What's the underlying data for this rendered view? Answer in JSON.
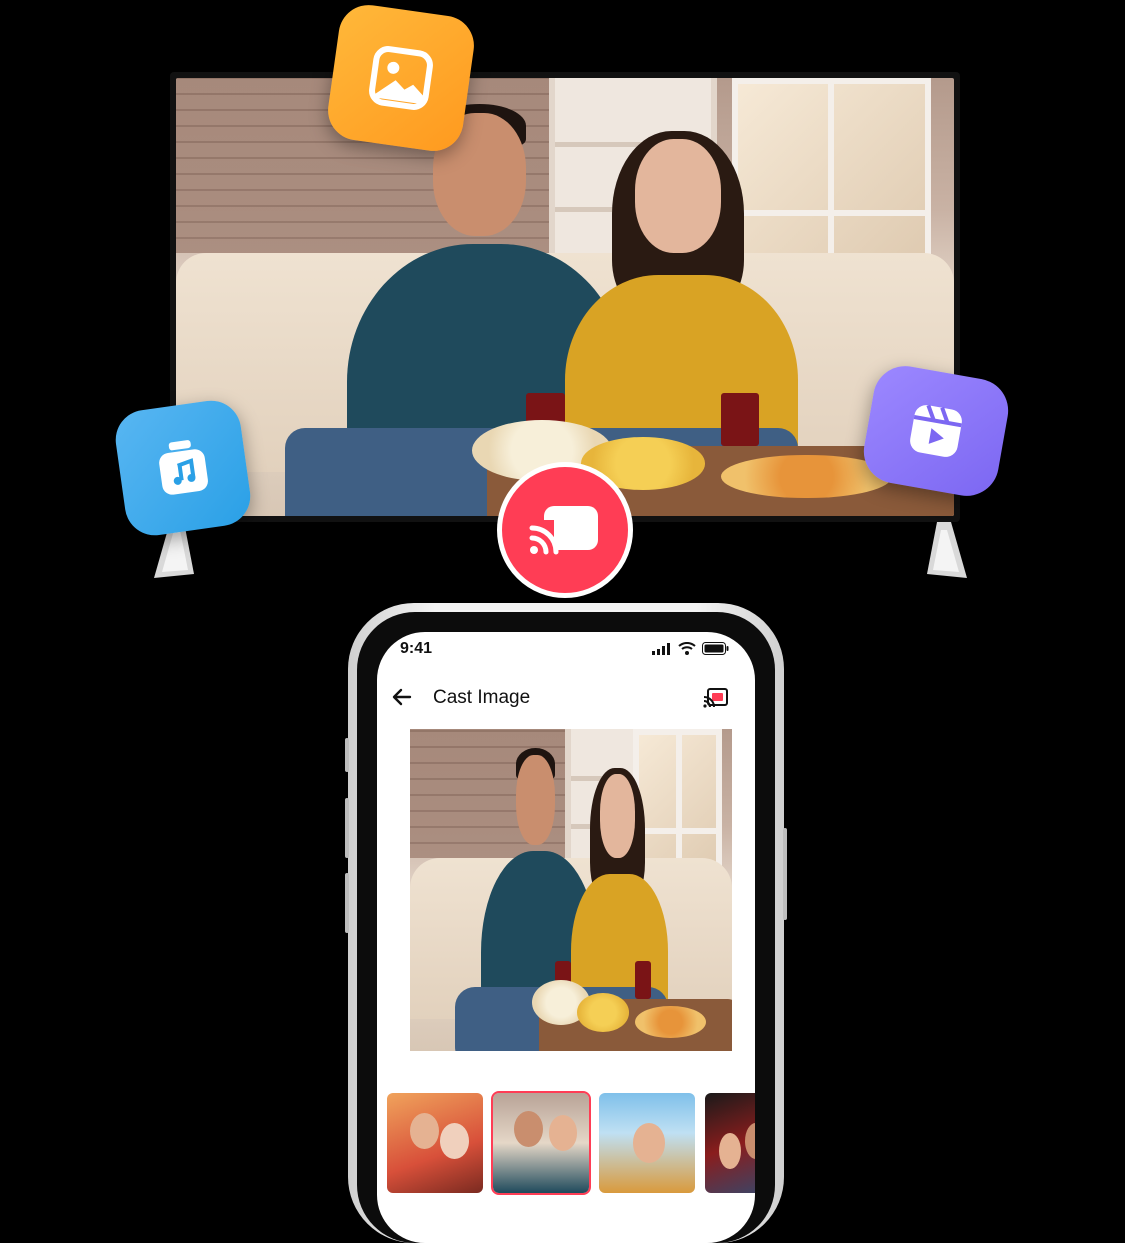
{
  "phone": {
    "status_time": "9:41",
    "screen_title": "Cast Image"
  },
  "icons": {
    "gallery": "image-icon",
    "music": "music-folder-icon",
    "reels": "reel-icon",
    "cast": "cast-icon"
  },
  "thumbnails": [
    {
      "name": "thumbnail-1",
      "selected": false
    },
    {
      "name": "thumbnail-2",
      "selected": true
    },
    {
      "name": "thumbnail-3",
      "selected": false
    },
    {
      "name": "thumbnail-4",
      "selected": false
    }
  ],
  "colors": {
    "cast_accent": "#ff3d55",
    "gallery_icon": "#ffa62b",
    "music_icon": "#3aa8ec",
    "reel_icon": "#8a76f8"
  }
}
